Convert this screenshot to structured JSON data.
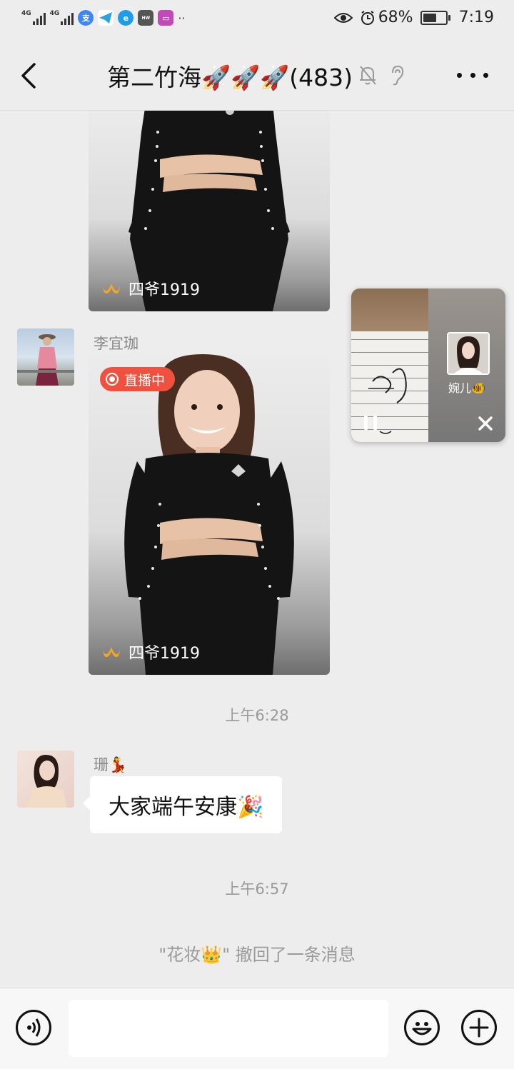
{
  "status_bar": {
    "network1": "4G",
    "network2": "4G",
    "battery_percent": "68%",
    "battery_level": 0.68,
    "time": "7:19",
    "overflow": "··"
  },
  "header": {
    "title": "第二竹海🚀🚀🚀(483)",
    "icons": [
      "back-arrow-icon",
      "mute-bell-icon",
      "ear-icon",
      "more-icon"
    ]
  },
  "messages": {
    "live1": {
      "host": "四爷1919"
    },
    "sender1": "李宜珈",
    "live2": {
      "badge": "直播中",
      "host": "四爷1919"
    },
    "time1": "上午6:28",
    "sender2": "珊💃",
    "text2": "大家端午安康🎉",
    "time2": "上午6:57",
    "recall": "\"花妆👑\" 撤回了一条消息"
  },
  "floating_window": {
    "name": "婉儿🐠"
  },
  "input_bar": {
    "placeholder": "",
    "icons": [
      "voice-icon",
      "emoji-icon",
      "plus-icon"
    ]
  },
  "colors": {
    "background": "#ededed",
    "live_badge": "#f0503e",
    "channels_logo": "#f5a623"
  }
}
